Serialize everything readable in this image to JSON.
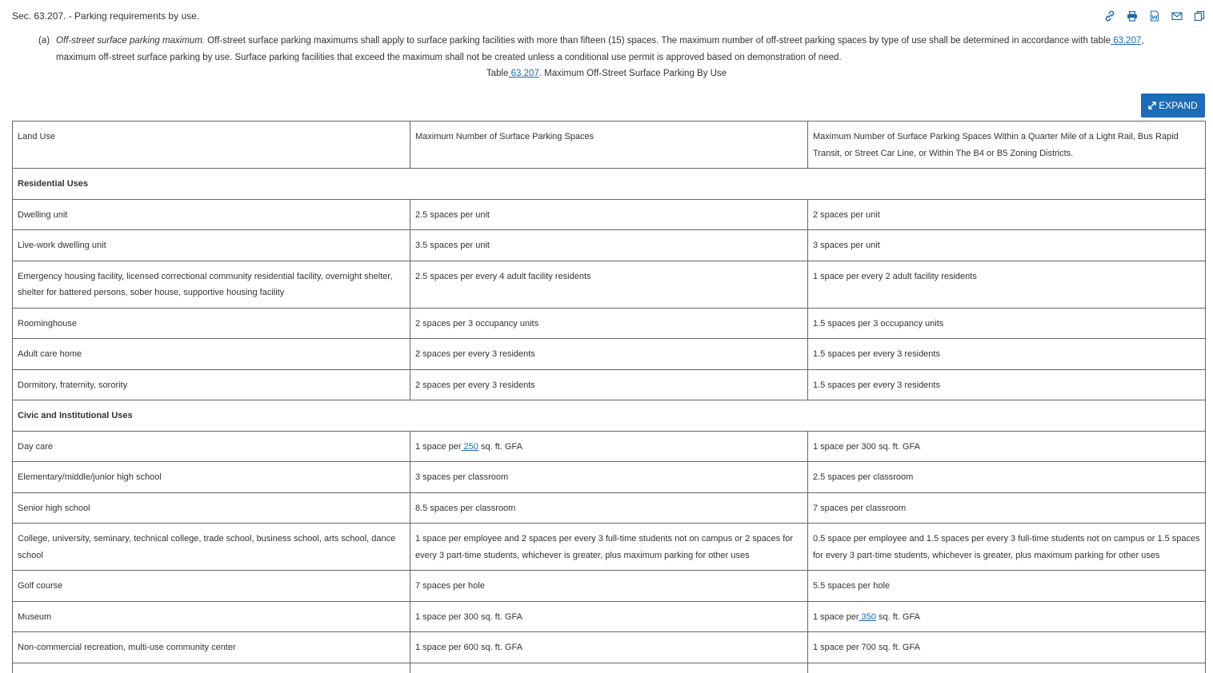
{
  "section_title": "Sec. 63.207. - Parking requirements by use.",
  "toolbar": {
    "icons": [
      "link-icon",
      "print-icon",
      "word-download-icon",
      "email-icon",
      "compare-icon"
    ]
  },
  "paragraph": {
    "marker": "(a)",
    "heading": "Off-street surface parking maximum.",
    "text_before_link": " Off-street surface parking maximums shall apply to surface parking facilities with more than fifteen (15) spaces. The maximum number of off-street parking spaces by type of use shall be determined in accordance with table",
    "link": " 63.207",
    "text_after_link": ",",
    "line2": "maximum off-street surface parking by use. Surface parking facilities that exceed the maximum shall not be created unless a conditional use permit is approved based on demonstration of need."
  },
  "caption": {
    "prefix": "Table",
    "link": " 63.207",
    "suffix": ". Maximum Off-Street Surface Parking By Use"
  },
  "expand_label": "EXPAND",
  "table": {
    "headers": [
      "Land Use",
      "Maximum Number of Surface Parking Spaces",
      "Maximum Number of Surface Parking Spaces Within a Quarter Mile of a Light Rail, Bus Rapid Transit, or Street Car Line, or Within The B4 or B5 Zoning Districts."
    ],
    "groups": {
      "residential": "Residential Uses",
      "civic": "Civic and Institutional Uses"
    },
    "rows": {
      "dwelling": [
        "Dwelling unit",
        "2.5 spaces per unit",
        "2 spaces per unit"
      ],
      "livework": [
        "Live-work dwelling unit",
        "3.5 spaces per unit",
        "3 spaces per unit"
      ],
      "emergency": [
        "Emergency housing facility, licensed correctional community residential facility, overnight shelter, shelter for battered persons, sober house, supportive housing facility",
        "2.5 spaces per every 4 adult facility residents",
        "1 space per every 2 adult facility residents"
      ],
      "roominghouse": [
        "Roominghouse",
        "2 spaces per 3 occupancy units",
        "1.5 spaces per 3 occupancy units"
      ],
      "adultcare": [
        "Adult care home",
        "2 spaces per every 3 residents",
        "1.5 spaces per every 3 residents"
      ],
      "dormitory": [
        "Dormitory, fraternity, sorority",
        "2 spaces per every 3 residents",
        "1.5 spaces per every 3 residents"
      ],
      "daycare": {
        "use": "Day care",
        "max_prefix": "1 space per",
        "max_link": " 250",
        "max_suffix": " sq. ft. GFA",
        "transit": "1 space per 300 sq. ft. GFA"
      },
      "elementary": [
        "Elementary/middle/junior high school",
        "3 spaces per classroom",
        "2.5 spaces per classroom"
      ],
      "seniorhigh": [
        "Senior high school",
        "8.5 spaces per classroom",
        "7 spaces per classroom"
      ],
      "college": [
        "College, university, seminary, technical college, trade school, business school, arts school, dance school",
        "1 space per employee and 2 spaces per every 3 full-time students not on campus or 2 spaces for every 3 part-time students, whichever is greater, plus maximum parking for other uses",
        "0.5 space per employee and 1.5 spaces per every 3 full-time students not on campus or 1.5 spaces for every 3 part-time students, whichever is greater, plus maximum parking for other uses"
      ],
      "golf": [
        "Golf course",
        "7 spaces per hole",
        "5.5 spaces per hole"
      ],
      "museum": {
        "use": "Museum",
        "max": "1 space per 300 sq. ft. GFA",
        "transit_prefix": "1 space per",
        "transit_link": " 350",
        "transit_suffix": " sq. ft. GFA"
      },
      "noncommercial": [
        "Non-commercial recreation, multi-use community center",
        "1 space per 600 sq. ft. GFA",
        "1 space per 700 sq. ft. GFA"
      ]
    }
  },
  "colors": {
    "link": "#1a6ab0",
    "button": "#1c6cb8",
    "border": "#666666"
  }
}
